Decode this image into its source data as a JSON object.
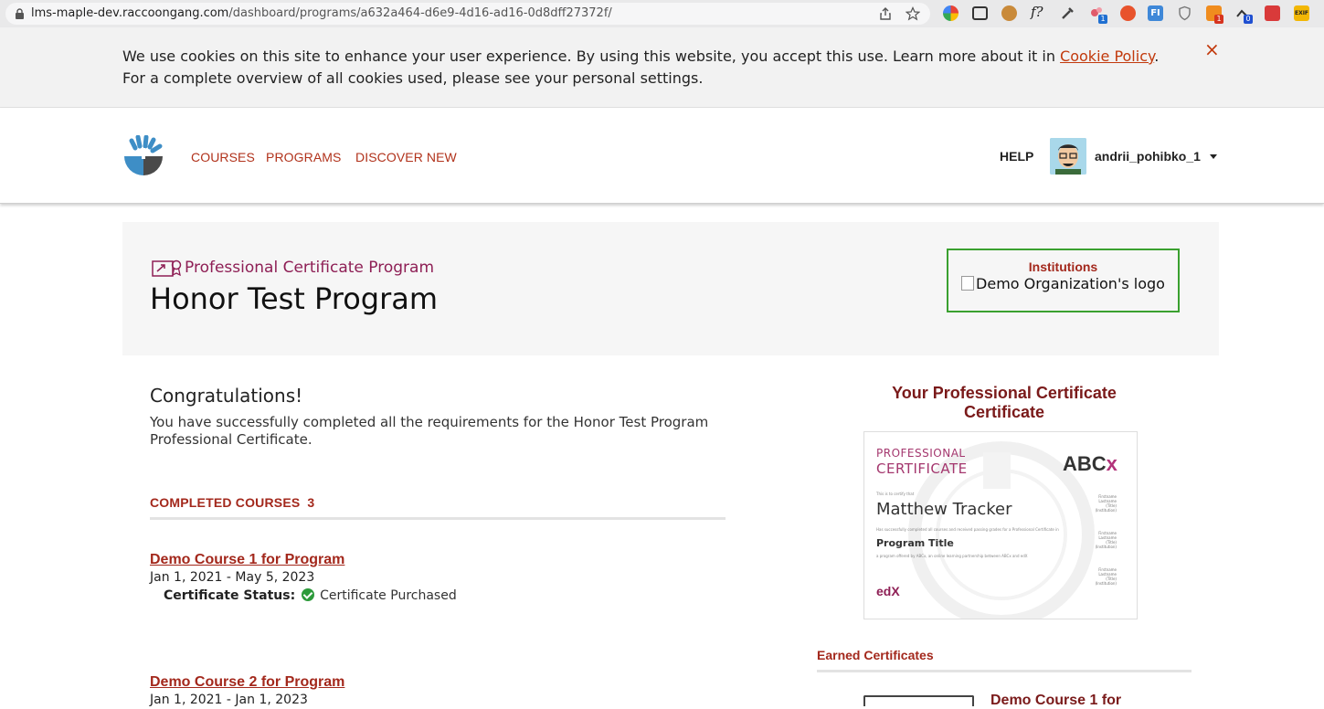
{
  "browser": {
    "url_host": "lms-maple-dev.raccoongang.com",
    "url_path": "/dashboard/programs/a632a464-d6e9-4d16-ad16-0d8dff27372f/"
  },
  "cookie_banner": {
    "text_before_link": "We use cookies on this site to enhance your user experience. By using this website, you accept this use. Learn more about it in ",
    "link_label": "Cookie Policy",
    "text_after_link": ".",
    "line2": "For a complete overview of all cookies used, please see your personal settings.",
    "close_glyph": "×"
  },
  "header": {
    "nav": [
      {
        "label": "COURSES"
      },
      {
        "label": "PROGRAMS"
      },
      {
        "label": "DISCOVER NEW"
      }
    ],
    "help_label": "HELP",
    "username": "andrii_pohibko_1"
  },
  "program": {
    "type_label": "Professional Certificate Program",
    "title": "Honor Test Program",
    "institutions_label": "Institutions",
    "institution_logo_alt": "Demo Organization's logo"
  },
  "completion": {
    "heading": "Congratulations!",
    "message": "You have successfully completed all the requirements for the Honor Test Program Professional Certificate."
  },
  "completed_courses": {
    "label": "COMPLETED COURSES",
    "count": "3",
    "items": [
      {
        "title": "Demo Course 1 for Program",
        "dates": "Jan 1, 2021 - May 5, 2023",
        "status_label": "Certificate Status:",
        "status_value": "Certificate Purchased"
      },
      {
        "title": "Demo Course 2 for Program",
        "dates": "Jan 1, 2021 - Jan 1, 2023"
      }
    ]
  },
  "sidebar": {
    "certificate_heading": "Your Professional Certificate Certificate",
    "certificate_preview": {
      "line1": "PROFESSIONAL",
      "line2": "CERTIFICATE",
      "brand_main": "ABC",
      "brand_accent": "x",
      "certify_text": "This is to certify that",
      "recipient": "Matthew Tracker",
      "completion_text": "Has successfully completed all courses and received passing grades for a Professional Certificate in",
      "program_name": "Program Title",
      "offered_text": "a program offered by ABCx, an online learning partnership between ABCx and edX",
      "edx_logo": "edX",
      "signatory_name": "Firstname Lastname",
      "signatory_title": "(Title)",
      "signatory_org": "(Institution)"
    },
    "earned_label": "Earned Certificates",
    "earned_course_title": "Demo Course 1 for"
  },
  "colors": {
    "accent_red": "#a3281c",
    "program_magenta": "#8e1f55",
    "institution_border": "#3aa02f",
    "success_green": "#2c9a3a"
  }
}
